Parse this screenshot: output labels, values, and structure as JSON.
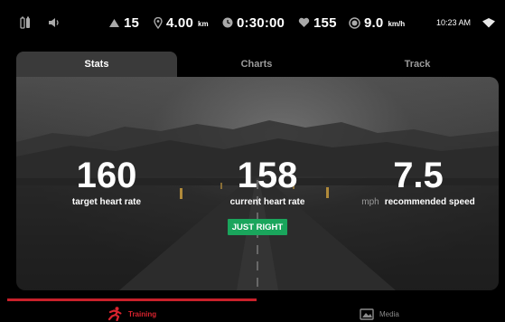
{
  "status_bar": {
    "icons": [
      "battery-icon",
      "speaker-icon",
      "incline-icon",
      "location-pin-icon",
      "clock-icon",
      "heart-icon",
      "speedometer-icon",
      "wifi-icon"
    ],
    "incline": "15",
    "distance": {
      "value": "4.00",
      "unit": "km"
    },
    "duration": "0:30:00",
    "heart_rate": "155",
    "speed": {
      "value": "9.0",
      "unit": "km/h"
    },
    "clock": "10:23 AM"
  },
  "tabs": [
    {
      "label": "Stats",
      "active": true
    },
    {
      "label": "Charts",
      "active": false
    },
    {
      "label": "Track",
      "active": false
    }
  ],
  "stats": {
    "target": {
      "value": "160",
      "label": "target heart rate"
    },
    "current": {
      "value": "158",
      "label": "current heart rate"
    },
    "speed": {
      "value": "7.5",
      "unit": "mph",
      "label": "recommended speed"
    },
    "status_badge": "JUST RIGHT"
  },
  "bottom_nav": [
    {
      "label": "Training",
      "icon": "runner-icon",
      "active": true
    },
    {
      "label": "Media",
      "icon": "media-icon",
      "active": false
    }
  ],
  "colors": {
    "accent_red": "#c8202a",
    "badge_green": "#1aa55c",
    "icon_gray": "#a9a9a9"
  }
}
